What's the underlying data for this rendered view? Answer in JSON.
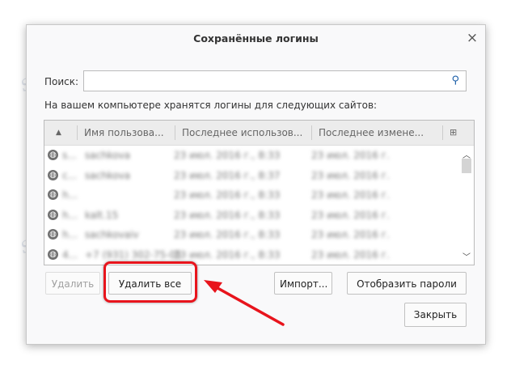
{
  "dialog": {
    "title": "Сохранённые логины",
    "close_icon": "×"
  },
  "search": {
    "label": "Поиск:",
    "value": "",
    "placeholder": ""
  },
  "description": "На вашем компьютере хранятся логины для следующих сайтов:",
  "table": {
    "columns": [
      "▲",
      "Имя пользова...",
      "Последнее использов...",
      "Последнее измене..."
    ],
    "rows": [
      {
        "site": "s...",
        "user": "sachkova",
        "last_used": "23 июл. 2016 г., 8:33",
        "last_changed": "23 июл. 2016 г."
      },
      {
        "site": "c...",
        "user": "sachkova",
        "last_used": "23 июл. 2016 г., 8:37",
        "last_changed": "23 июл. 2016 г."
      },
      {
        "site": "h...",
        "user": "",
        "last_used": "23 июл. 2016 г., 8:33",
        "last_changed": "23 июл. 2016 г."
      },
      {
        "site": "h...",
        "user": "kalt.15",
        "last_used": "23 июл. 2016 г., 8:33",
        "last_changed": "23 июл. 2016 г."
      },
      {
        "site": "h...",
        "user": "sachkovaiv",
        "last_used": "23 июл. 2016 г., 8:33",
        "last_changed": "23 июл. 2016 г."
      },
      {
        "site": "4...",
        "user": "+7 (931) 302-75-05",
        "last_used": "23 июл. 2016 г., 8:33",
        "last_changed": "23 июл. 2016 г."
      }
    ]
  },
  "buttons": {
    "delete": "Удалить",
    "delete_all": "Удалить все",
    "import": "Импорт...",
    "show_passwords": "Отобразить пароли",
    "close": "Закрыть"
  },
  "watermark": "Soringpcrepair.Com",
  "colors": {
    "highlight": "#e8141c"
  }
}
